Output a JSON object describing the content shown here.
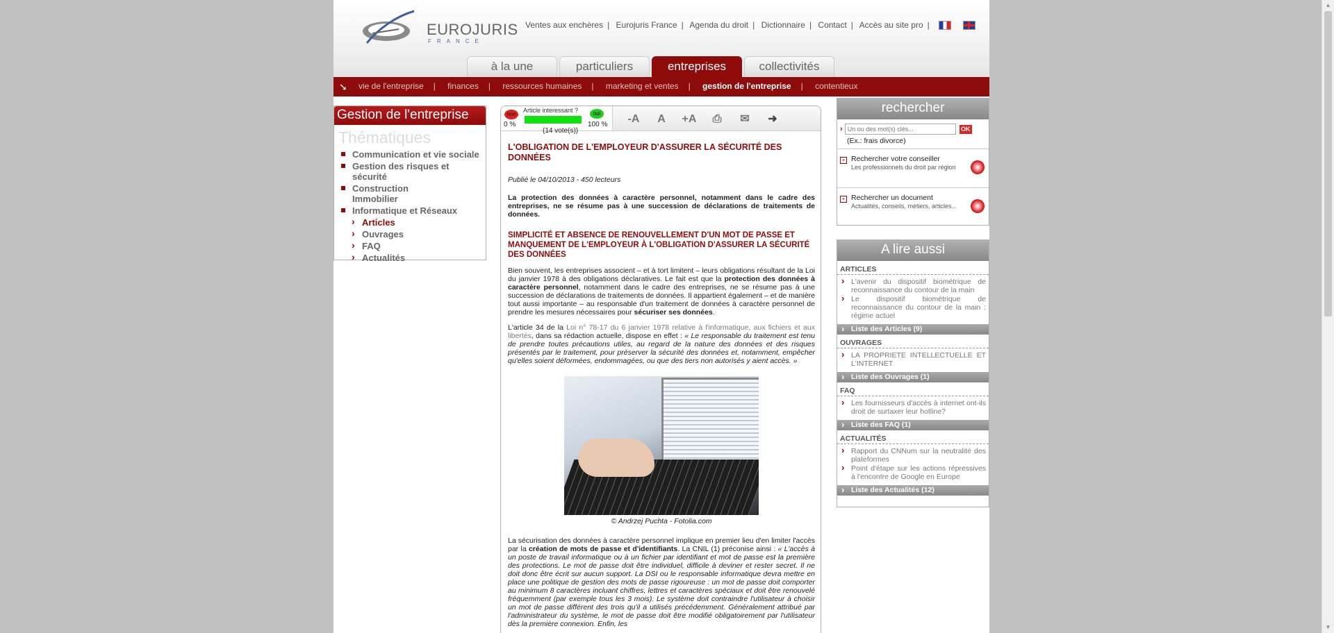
{
  "header": {
    "logo_text": "EUROJURIS",
    "logo_sub": "FRANCE",
    "topnav": [
      "Ventes aux enchères",
      "Eurojuris France",
      "Agenda du droit",
      "Dictionnaire",
      "Contact",
      "Accès au site pro"
    ],
    "tabs": [
      "à la une",
      "particuliers",
      "entreprises",
      "collectivités"
    ],
    "active_tab": "entreprises"
  },
  "subnav": {
    "items": [
      "vie de l'entreprise",
      "finances",
      "ressources humaines",
      "marketing et ventes",
      "gestion de l'entreprise",
      "contentieux"
    ],
    "current": "gestion de l'entreprise"
  },
  "left": {
    "title": "Gestion de l'entreprise",
    "subtitle": "Thématiques",
    "items": [
      "Communication et vie sociale",
      "Gestion des risques et sécurité",
      "Construction Immobilier",
      "Informatique et Réseaux"
    ],
    "subitems": [
      "Articles",
      "Ouvrages",
      "FAQ",
      "Actualités"
    ],
    "active_subitem": "Articles"
  },
  "vote": {
    "question": "Article interessant ?",
    "no_label": "non",
    "yes_label": "oui",
    "no_pct": "0 %",
    "yes_pct": "100 %",
    "count": "(14 vote(s))",
    "yes_fraction": 1.0
  },
  "tools": [
    "text-smaller-icon",
    "text-default-icon",
    "text-larger-icon",
    "print-icon",
    "email-icon",
    "share-arrow-icon"
  ],
  "article": {
    "title": "L'OBLIGATION DE L'EMPLOYEUR D'ASSURER LA SÉCURITÉ DES DONNÉES",
    "meta": "Publié le 04/10/2013 - 450 lecteurs",
    "lead": "La protection des données à caractère personnel, notamment dans le cadre des entreprises, ne se résume pas à une succession de déclarations de traitements de données.",
    "h2": "SIMPLICITÉ ET ABSENCE DE RENOUVELLEMENT D'UN MOT DE PASSE ET MANQUEMENT DE L'EMPLOYEUR À L'OBLIGATION D'ASSURER LA SÉCURITÉ DES DONNÉES",
    "p1_a": "Bien souvent, les entreprises associent – et à tort limitent – leurs obligations résultant de la Loi du janvier 1978 à des obligations déclaratives. Le fait est que la ",
    "p1_b": "protection des données à caractère personnel",
    "p1_c": ", notamment dans le cadre des entreprises, ne se résume pas à une succession de déclarations de traitements de données. Il appartient également – et de manière tout aussi importante – au responsable d'un traitement de données à caractère personnel de prendre les mesures nécessaires pour ",
    "p1_d": "sécuriser ses données",
    "p1_e": ".",
    "p2_a": "L'article 34 de la ",
    "p2_link": "Loi n° 78-17 du 6 janvier 1978 relative à l'informatique, aux fichiers et aux libertés",
    "p2_b": ", dans sa rédaction actuelle, dispose en effet : ",
    "p2_quote": "« Le responsable du traitement est tenu de prendre toutes précautions utiles, au regard de la nature des données et des risques présentés par le traitement, pour préserver la sécurité des données et, notamment, empêcher qu'elles soient déformées, endommagées, ou que des tiers non autorisés y aient accès. »",
    "caption": "© Andrzej Puchta - Fotolia.com",
    "p3_a": "La sécurisation des données à caractère personnel implique en premier lieu d'en limiter l'accès par la ",
    "p3_b": "création de mots de passe et d'identifiants",
    "p3_c": ". La CNIL (1) préconise ainsi : ",
    "p3_quote": "« L'accès à un poste de travail informatique ou à un fichier par identifiant et mot de passe est la première des protections. Le mot de passe doit être individuel, difficile à deviner et rester secret. Il ne doit donc être écrit sur aucun support. La DSI ou le responsable informatique devra mettre en place une politique de gestion des mots de passe rigoureuse : un mot de passe doit comporter au minimum 8 caractères incluant chiffres, lettres et caractères spéciaux et doit être renouvelé fréquemment (par exemple tous les 3 mois). Le système doit contraindre l'utilisateur à choisir un mot de passe différent des trois qu'il a utilisés précédemment. Généralement attribué par l'administrateur du système, le mot de passe doit être modifié obligatoirement par l'utilisateur dès la première connexion. Enfin, les"
  },
  "search": {
    "title": "rechercher",
    "placeholder": "Un ou des mot(s) clés...",
    "ok": "OK",
    "example": "(Ex.: frais divorce)",
    "links": [
      {
        "title": "Rechercher votre conseiller",
        "desc": "Les professionnels du droit par région"
      },
      {
        "title": "Rechercher un document",
        "desc": "Actualités, conseils, métiers, articles..."
      }
    ]
  },
  "also": {
    "title": "A lire aussi",
    "articles_label": "ARTICLES",
    "articles": [
      "L'avenir du dispositif biométrique de reconnaissance du contour de la main",
      "Le dispositif biométrique de reconnaissance du contour de la main : régime actuel"
    ],
    "articles_more": "Liste des Articles (9)",
    "ouvrages_label": "OUVRAGES",
    "ouvrages": [
      "LA PROPRIETE INTELLECTUELLE ET L'INTERNET"
    ],
    "ouvrages_more": "Liste des Ouvrages (1)",
    "faq_label": "FAQ",
    "faq": [
      "Les fournisseurs d'accès à internet ont-ils droit de surtaxer leur hotline?"
    ],
    "faq_more": "Liste des FAQ (1)",
    "actu_label": "ACTUALITÉS",
    "actu": [
      "Rapport du CNNum sur la neutralité des plateformes",
      "Point d'étape sur les actions répressives à l'encontre de Google en Europe"
    ],
    "actu_more": "Liste des Actualités (12)"
  }
}
